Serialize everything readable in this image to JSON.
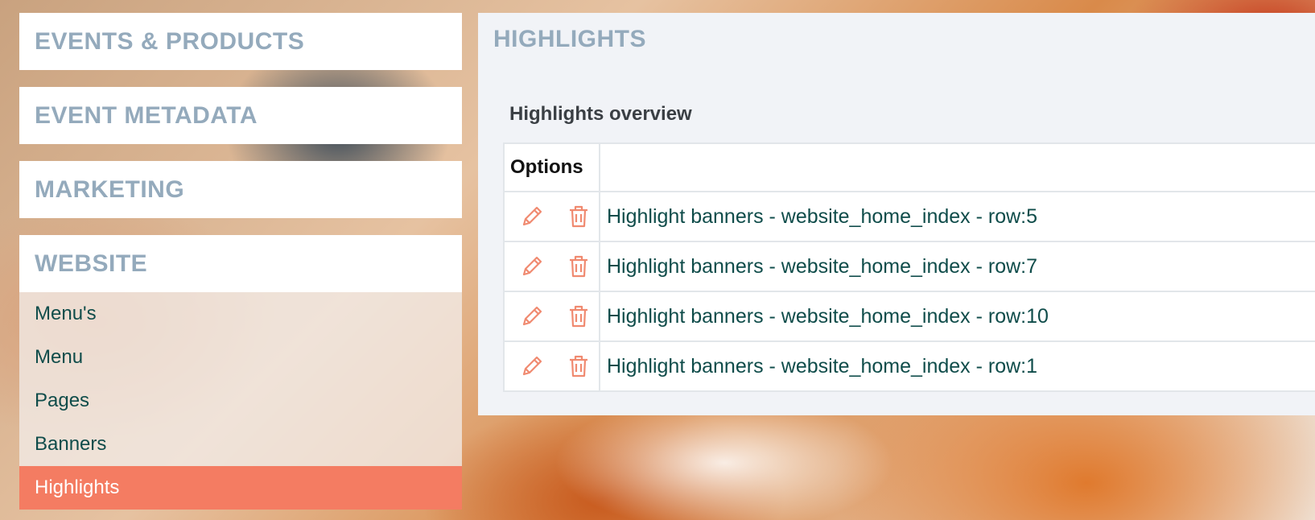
{
  "sidebar": {
    "categories": [
      {
        "label": "EVENTS & PRODUCTS"
      },
      {
        "label": "EVENT METADATA"
      },
      {
        "label": "MARKETING"
      },
      {
        "label": "WEBSITE"
      }
    ],
    "website_items": [
      {
        "label": "Menu's"
      },
      {
        "label": "Menu"
      },
      {
        "label": "Pages"
      },
      {
        "label": "Banners"
      },
      {
        "label": "Highlights",
        "active": true
      }
    ]
  },
  "main": {
    "title": "HIGHLIGHTS",
    "subtitle": "Highlights overview",
    "table": {
      "columns": [
        "Options",
        ""
      ],
      "rows": [
        {
          "name": "Highlight banners - website_home_index - row:5"
        },
        {
          "name": "Highlight banners - website_home_index - row:7"
        },
        {
          "name": "Highlight banners - website_home_index - row:10"
        },
        {
          "name": "Highlight banners - website_home_index - row:1"
        }
      ]
    }
  },
  "icons": {
    "edit": "pencil-icon",
    "delete": "trash-icon"
  },
  "colors": {
    "accent": "#f47c62",
    "category_text": "#94aabc",
    "link_text": "#0f4c4a",
    "icon": "#f08a70"
  }
}
